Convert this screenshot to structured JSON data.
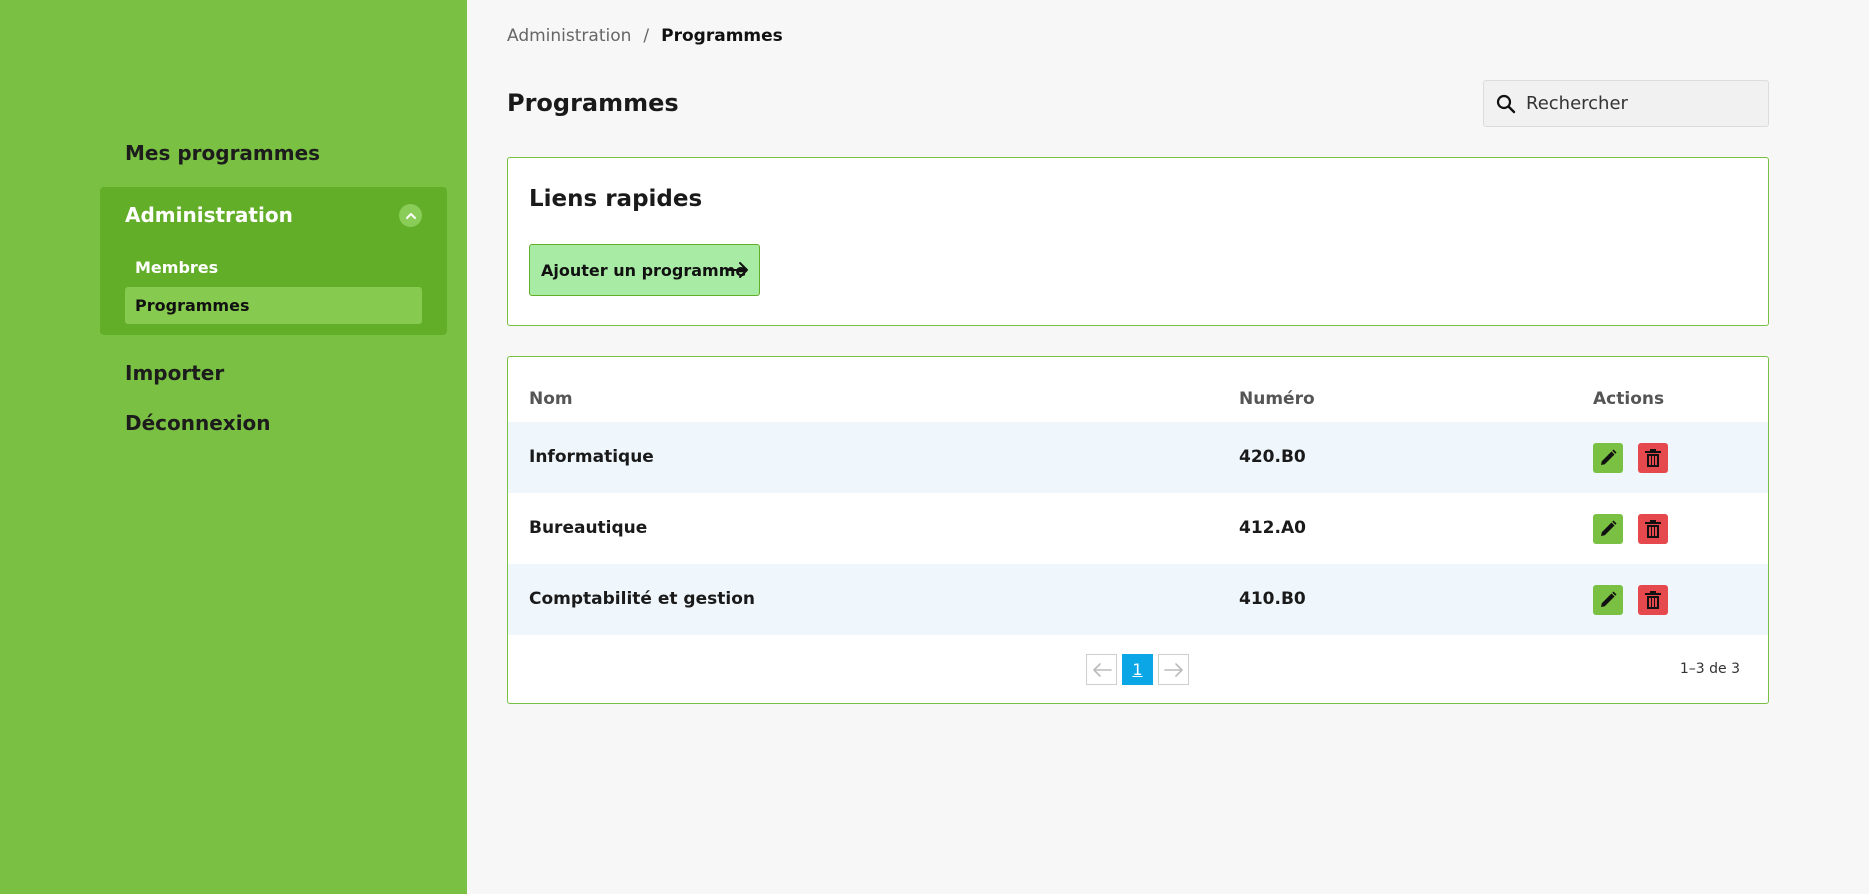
{
  "sidebar": {
    "items": [
      {
        "label": "Mes programmes"
      },
      {
        "label": "Administration",
        "expanded": true,
        "children": [
          {
            "label": "Membres"
          },
          {
            "label": "Programmes",
            "active": true
          }
        ]
      },
      {
        "label": "Importer"
      },
      {
        "label": "Déconnexion"
      }
    ]
  },
  "breadcrumb": {
    "parent": "Administration",
    "separator": "/",
    "current": "Programmes"
  },
  "page": {
    "title": "Programmes"
  },
  "search": {
    "placeholder": "Rechercher"
  },
  "quick_links": {
    "title": "Liens rapides",
    "add_button": "Ajouter un programme"
  },
  "table": {
    "columns": [
      "Nom",
      "Numéro",
      "Actions"
    ],
    "rows": [
      {
        "name": "Informatique",
        "number": "420.B0"
      },
      {
        "name": "Bureautique",
        "number": "412.A0"
      },
      {
        "name": "Comptabilité et gestion",
        "number": "410.B0"
      }
    ],
    "pagination": {
      "current_page": "1",
      "count_text": "1–3 de 3"
    }
  },
  "colors": {
    "sidebar": "#7ac143",
    "admin_group": "#62ae29",
    "edit": "#7ac143",
    "delete": "#e5484d",
    "page_active": "#0aa6e6"
  },
  "icons": [
    "chevron-up-icon",
    "search-icon",
    "arrow-right-icon",
    "pencil-icon",
    "trash-icon",
    "arrow-left-icon"
  ]
}
